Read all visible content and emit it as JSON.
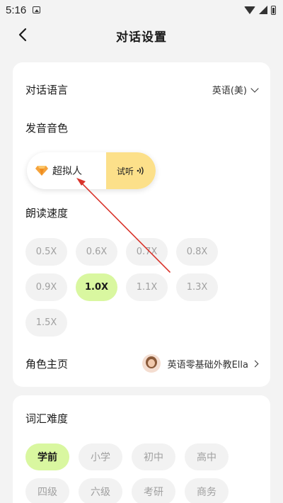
{
  "status_bar": {
    "time": "5:16"
  },
  "header": {
    "title": "对话设置"
  },
  "conversation_language": {
    "label": "对话语言",
    "value": "英语(美)"
  },
  "voice": {
    "label": "发音音色",
    "selected_name": "超拟人",
    "try_label": "试听"
  },
  "speed": {
    "label": "朗读速度",
    "options": [
      "0.5X",
      "0.6X",
      "0.7X",
      "0.8X",
      "0.9X",
      "1.0X",
      "1.1X",
      "1.3X",
      "1.5X"
    ],
    "selected": "1.0X"
  },
  "role": {
    "label": "角色主页",
    "value": "英语零基础外教Ella"
  },
  "vocabulary": {
    "label": "词汇难度",
    "options": [
      "学前",
      "小学",
      "初中",
      "高中",
      "四级",
      "六级",
      "考研",
      "商务"
    ],
    "selected": "学前"
  },
  "colors": {
    "accent_selected": "#d9f7a0",
    "try_button": "#fce08a",
    "annotation_arrow": "#d9342b"
  }
}
